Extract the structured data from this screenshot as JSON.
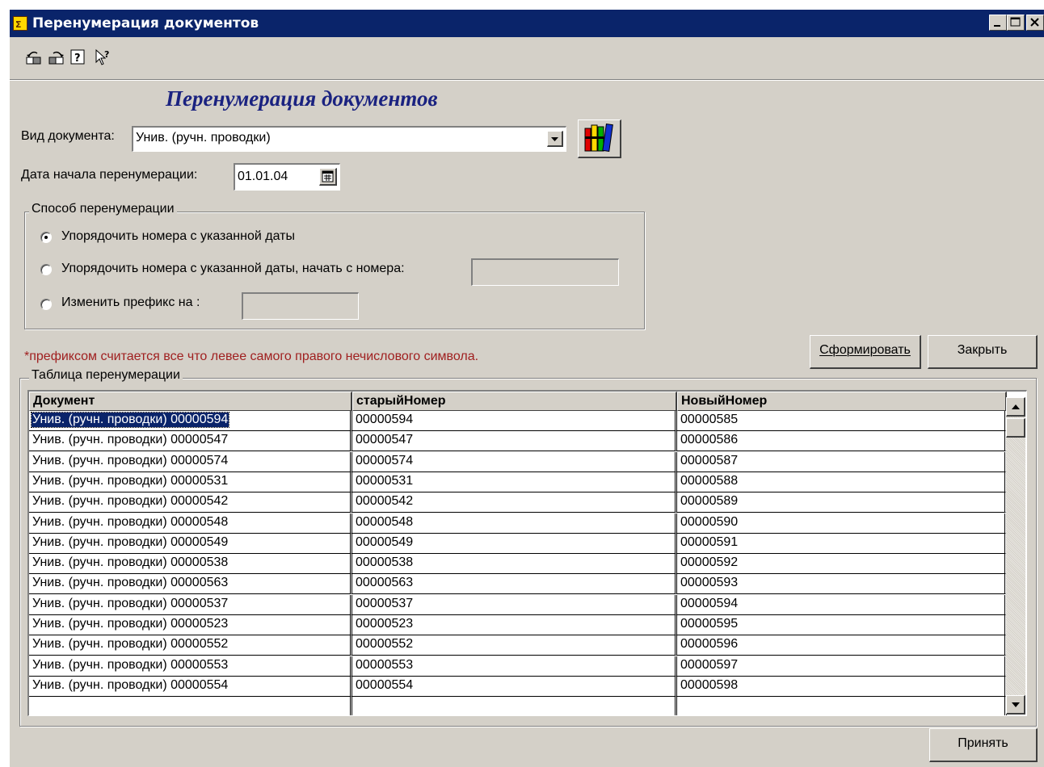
{
  "window": {
    "title": "Перенумерация документов",
    "buttons": {
      "minimize": "_",
      "maximize": "□",
      "close": "X"
    }
  },
  "toolbar": {
    "icons": [
      "back-icon",
      "forward-icon",
      "help-icon",
      "context-help-icon"
    ],
    "help_glyph": "?"
  },
  "form": {
    "heading": "Перенумерация документов",
    "doc_type_label": "Вид документа:",
    "doc_type_value": "Унив. (ручн. проводки)",
    "start_date_label": "Дата начала перенумерации:",
    "start_date_value": "01.01.04",
    "method_group_title": "Способ перенумерации",
    "method_options": [
      {
        "label": "Упорядочить номера с указанной даты",
        "checked": true
      },
      {
        "label": "Упорядочить номера с указанной даты, начать с номера:",
        "checked": false
      },
      {
        "label": "Изменить префикс на :",
        "checked": false
      }
    ],
    "note": "*префиксом считается все что левее самого правого нечислового символа.",
    "form_button": "Сформировать",
    "close_button": "Закрыть",
    "accept_button": "Принять"
  },
  "table": {
    "group_title": "Таблица перенумерации",
    "columns": [
      "Документ",
      "старыйНомер",
      "НовыйНомер"
    ],
    "rows": [
      [
        "Унив. (ручн. проводки) 00000594",
        "00000594",
        "00000585"
      ],
      [
        "Унив. (ручн. проводки) 00000547",
        "00000547",
        "00000586"
      ],
      [
        "Унив. (ручн. проводки) 00000574",
        "00000574",
        "00000587"
      ],
      [
        "Унив. (ручн. проводки) 00000531",
        "00000531",
        "00000588"
      ],
      [
        "Унив. (ручн. проводки) 00000542",
        "00000542",
        "00000589"
      ],
      [
        "Унив. (ручн. проводки) 00000548",
        "00000548",
        "00000590"
      ],
      [
        "Унив. (ручн. проводки) 00000549",
        "00000549",
        "00000591"
      ],
      [
        "Унив. (ручн. проводки) 00000538",
        "00000538",
        "00000592"
      ],
      [
        "Унив. (ручн. проводки) 00000563",
        "00000563",
        "00000593"
      ],
      [
        "Унив. (ручн. проводки) 00000537",
        "00000537",
        "00000594"
      ],
      [
        "Унив. (ручн. проводки) 00000523",
        "00000523",
        "00000595"
      ],
      [
        "Унив. (ручн. проводки) 00000552",
        "00000552",
        "00000596"
      ],
      [
        "Унив. (ручн. проводки) 00000553",
        "00000553",
        "00000597"
      ],
      [
        "Унив. (ручн. проводки) 00000554",
        "00000554",
        "00000598"
      ]
    ],
    "selected_row": 0
  },
  "colors": {
    "titlebar": "#0a246a",
    "heading": "#1a2280",
    "note": "#a02020",
    "face": "#d4d0c8"
  }
}
